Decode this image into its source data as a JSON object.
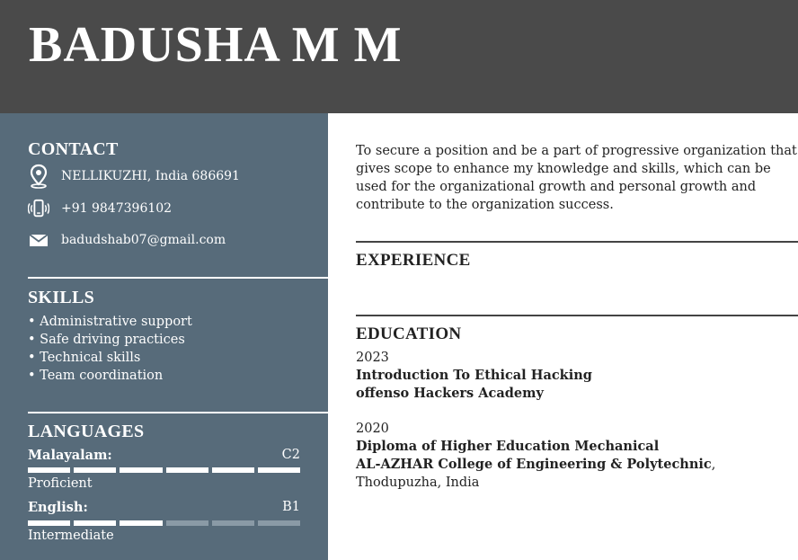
{
  "header": {
    "name": "BADUSHA M M"
  },
  "contact": {
    "title": "CONTACT",
    "items": [
      {
        "icon": "location-pin-icon",
        "text": "NELLIKUZHI, India 686691"
      },
      {
        "icon": "phone-icon",
        "text": "+91 9847396102"
      },
      {
        "icon": "mail-icon",
        "text": "badudshab07@gmail.com"
      }
    ]
  },
  "skills": {
    "title": "SKILLS",
    "items": [
      "• Administrative support",
      "• Safe driving practices",
      "• Technical skills",
      "• Team coordination"
    ]
  },
  "languages": {
    "title": "LANGUAGES",
    "items": [
      {
        "name": "Malayalam:",
        "level": "C2",
        "segments_filled": 6,
        "segments_total": 6,
        "description": "Proficient"
      },
      {
        "name": "English:",
        "level": "B1",
        "segments_filled": 3,
        "segments_total": 6,
        "description": "Intermediate"
      }
    ]
  },
  "summary": "To secure a position and be a part of progressive organization that gives scope to enhance my knowledge and skills, which can be used for the organizational growth and personal growth and contribute to the organization success.",
  "experience": {
    "title": "EXPERIENCE"
  },
  "education": {
    "title": "EDUCATION",
    "items": [
      {
        "year": "2023",
        "degree": "Introduction To Ethical Hacking",
        "institution": "offenso Hackers Academy",
        "location": ""
      },
      {
        "year": "2020",
        "degree": "Diploma of Higher Education Mechanical",
        "institution": "AL-AZHAR College of Engineering & Polytechnic",
        "location": ", Thodupuzha, India"
      }
    ]
  },
  "colors": {
    "header_bg": "#4a4a4a",
    "sidebar_bg": "#576b7a",
    "text_light": "#ffffff",
    "bar_empty": "#8a9aa6"
  }
}
